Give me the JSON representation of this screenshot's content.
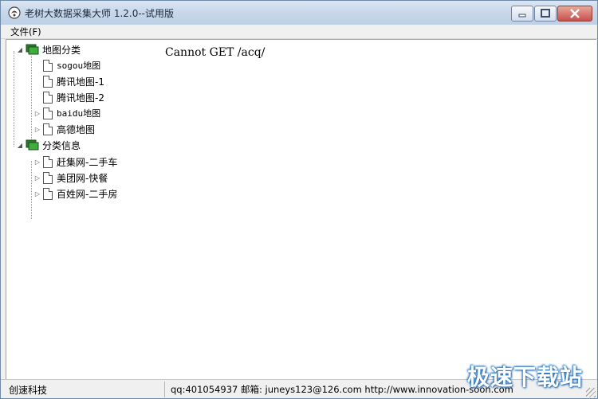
{
  "window": {
    "title": "老树大数据采集大师 1.2.0--试用版"
  },
  "menubar": {
    "file": "文件(F)"
  },
  "tree": {
    "groups": [
      {
        "label": "地图分类",
        "items": [
          "sogou地图",
          "腾讯地图-1",
          "腾讯地图-2",
          "baidu地图",
          "高德地图"
        ]
      },
      {
        "label": "分类信息",
        "items": [
          "赶集网-二手车",
          "美团网-快餐",
          "百姓网-二手房"
        ]
      }
    ]
  },
  "content": {
    "message": "Cannot GET /acq/"
  },
  "statusbar": {
    "left": "创速科技",
    "right": "qq:401054937 邮箱: juneys123@126.com http://www.innovation-soon.com"
  },
  "watermark": "极速下载站",
  "icons": {
    "app": "app-logo-icon",
    "folder": "folder-icon",
    "document": "document-icon",
    "expanded": "expanded-arrow-icon",
    "collapsed": "collapsed-arrow-icon"
  }
}
